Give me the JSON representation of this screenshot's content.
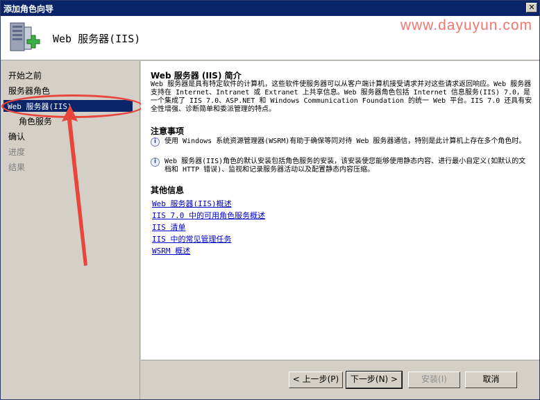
{
  "window": {
    "title": "添加角色向导",
    "close_label": "✕"
  },
  "header": {
    "title": "Web 服务器(IIS)",
    "watermark": "www.dayuyun.com"
  },
  "sidebar": {
    "items": [
      {
        "label": "开始之前",
        "state": "normal"
      },
      {
        "label": "服务器角色",
        "state": "normal"
      },
      {
        "label": "Web 服务器(IIS)",
        "state": "active"
      },
      {
        "label": "角色服务",
        "state": "sub"
      },
      {
        "label": "确认",
        "state": "normal"
      },
      {
        "label": "进度",
        "state": "disabled"
      },
      {
        "label": "结果",
        "state": "disabled"
      }
    ]
  },
  "content": {
    "intro_title": "Web 服务器 (IIS) 简介",
    "intro_text": "Web 服务器是具有特定软件的计算机，这些软件使服务器可以从客户端计算机接受请求并对这些请求返回响应。Web 服务器支持在 Internet、Intranet 或 Extranet 上共享信息。Web 服务器角色包括 Internet 信息服务(IIS) 7.0，是一个集成了 IIS 7.0、ASP.NET 和 Windows Communication Foundation 的统一 Web 平台。IIS 7.0 还具有安全性增强、诊断简单和委派管理的特点。",
    "notes_title": "注意事项",
    "notes": [
      "使用 Windows 系统资源管理器(WSRM)有助于确保等同对待 Web 服务器通信，特别是此计算机上存在多个角色时。",
      "Web 服务器(IIS)角色的默认安装包括角色服务的安装，该安装使您能够使用静态内容、进行最小自定义(如默认的文档和 HTTP 错误)、监视和记录服务器活动以及配置静态内容压缩。"
    ],
    "info_title": "其他信息",
    "links": [
      "Web 服务器(IIS)概述",
      "IIS 7.0 中的可用角色服务概述",
      "IIS 清单",
      "IIS 中的常见管理任务",
      "WSRM 概述"
    ]
  },
  "buttons": {
    "prev": "< 上一步(P)",
    "next": "下一步(N) >",
    "install": "安装(I)",
    "cancel": "取消"
  },
  "colors": {
    "titlebar": "#0a246a",
    "active_item": "#0a246a",
    "annotation": "#e8453c",
    "watermark": "#f2776f",
    "link": "#0000cc"
  }
}
